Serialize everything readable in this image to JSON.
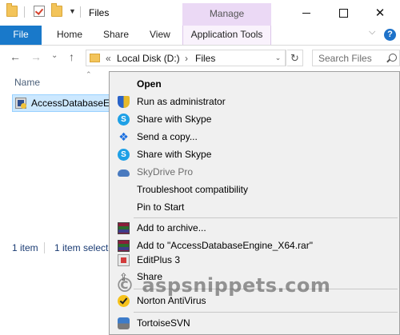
{
  "window": {
    "title": "Files",
    "contextual_tab": "Manage",
    "controls": {
      "minimize_icon": "minimize-icon",
      "maximize_icon": "maximize-icon",
      "close_icon": "close-icon"
    }
  },
  "ribbon": {
    "tabs": [
      "File",
      "Home",
      "Share",
      "View",
      "Application Tools"
    ],
    "file_tab_color": "#1979ca",
    "contextual_color": "#ebd9f5"
  },
  "address": {
    "overflow": "«",
    "segments": [
      "Local Disk (D:)",
      "Files"
    ],
    "search_placeholder": "Search Files"
  },
  "list": {
    "column_name": "Name",
    "file_name": "AccessDatabaseEngine_X64"
  },
  "status": {
    "count": "1 item",
    "selected": "1 item selecte"
  },
  "context_menu": {
    "items": [
      {
        "label": "Open",
        "icon": "",
        "bold": true
      },
      {
        "label": "Run as administrator",
        "icon": "shield-icon"
      },
      {
        "label": "Share with Skype",
        "icon": "skype-icon"
      },
      {
        "label": "Send a copy...",
        "icon": "dropbox-icon"
      },
      {
        "label": "Share with Skype",
        "icon": "skype-icon"
      },
      {
        "label": "SkyDrive Pro",
        "icon": "cloud-icon",
        "disabled": true
      },
      {
        "label": "Troubleshoot compatibility",
        "icon": ""
      },
      {
        "label": "Pin to Start",
        "icon": ""
      },
      {
        "label": "Add to archive...",
        "icon": "winrar-icon"
      },
      {
        "label": "Add to \"AccessDatabaseEngine_X64.rar\"",
        "icon": "winrar-icon"
      },
      {
        "label": "EditPlus 3",
        "icon": "editplus-icon"
      },
      {
        "label": "Share",
        "icon": "share-icon"
      },
      {
        "label": "Norton AntiVirus",
        "icon": "norton-icon"
      },
      {
        "label": "TortoiseSVN",
        "icon": "tortoisesvn-icon"
      }
    ]
  },
  "watermark": "© aspsnippets.com"
}
